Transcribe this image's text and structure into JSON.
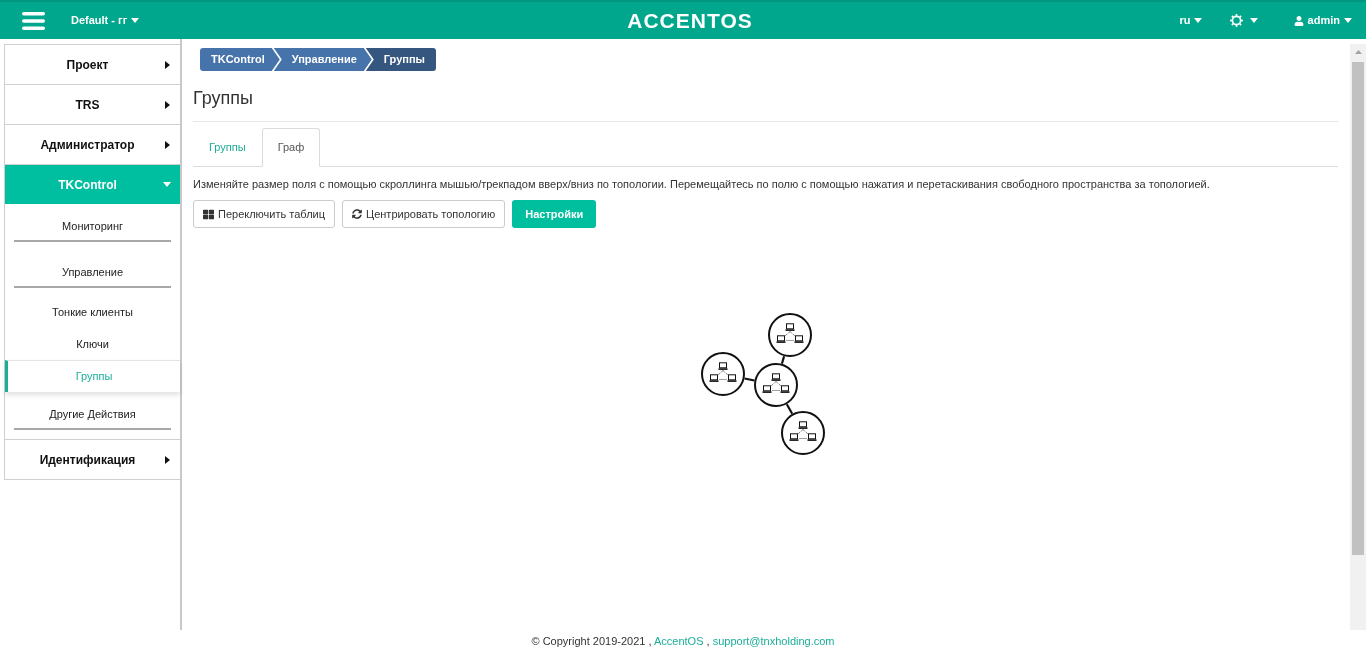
{
  "header": {
    "project": "Default - гг",
    "logo": "ACCENTOS",
    "language": "ru",
    "user": "admin"
  },
  "sidebar": {
    "items": [
      {
        "label": "Проект",
        "expanded": false
      },
      {
        "label": "TRS",
        "expanded": false
      },
      {
        "label": "Администратор",
        "expanded": false
      },
      {
        "label": "TKControl",
        "expanded": true,
        "children": [
          {
            "label": "Мониторинг"
          },
          {
            "label": "Управление",
            "children": [
              {
                "label": "Тонкие клиенты",
                "selected": false
              },
              {
                "label": "Ключи",
                "selected": false
              },
              {
                "label": "Группы",
                "selected": true
              }
            ]
          },
          {
            "label": "Другие Действия"
          }
        ]
      },
      {
        "label": "Идентификация",
        "expanded": false
      }
    ]
  },
  "breadcrumb": [
    {
      "label": "TKControl",
      "current": false
    },
    {
      "label": "Управление",
      "current": false
    },
    {
      "label": "Группы",
      "current": true
    }
  ],
  "page_title": "Группы",
  "tabs": [
    {
      "label": "Группы",
      "selected": false
    },
    {
      "label": "Граф",
      "selected": true
    }
  ],
  "hint": "Изменяйте размер поля с помощью скроллинга мышью/трекпадом вверх/вниз по топологии. Перемещайтесь по полю с помощью нажатия и перетаскивания свободного пространства за топологией.",
  "buttons": [
    {
      "label": "Переключить таблиц",
      "kind": "default"
    },
    {
      "label": "Центрировать топологию",
      "kind": "default"
    },
    {
      "label": "Настройки",
      "kind": "primary"
    }
  ],
  "footer": {
    "copyright": "© Copyright 2019-2021 ,",
    "links": [
      {
        "text": "AccentOS",
        "after": ","
      },
      {
        "text": "support@tnxholding.com"
      }
    ]
  }
}
